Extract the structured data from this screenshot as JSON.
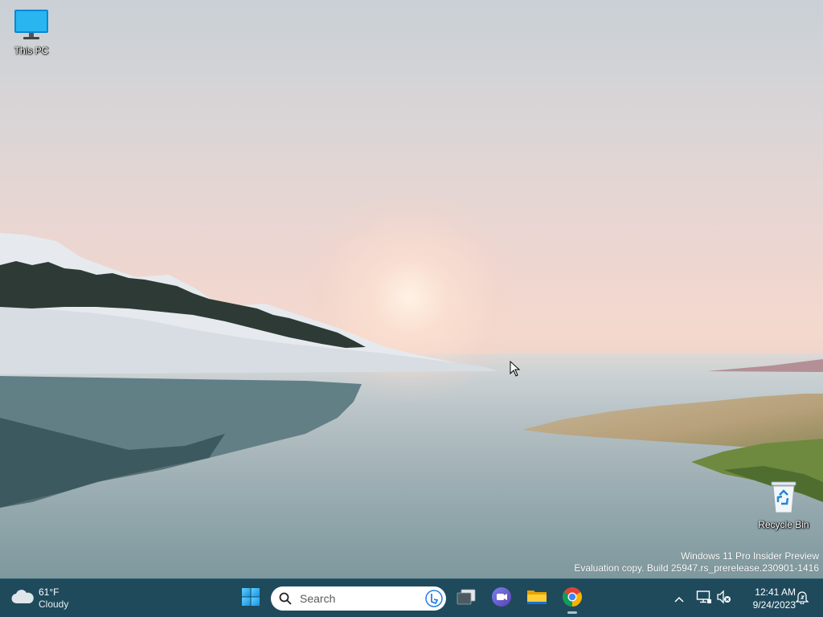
{
  "desktop": {
    "icons": [
      {
        "label": "This PC",
        "icon": "monitor-icon"
      },
      {
        "label": "Recycle Bin",
        "icon": "recycle-bin-icon"
      }
    ],
    "watermark": {
      "line1": "Windows 11 Pro Insider Preview",
      "line2": "Evaluation copy. Build 25947.rs_prerelease.230901-1416"
    }
  },
  "taskbar": {
    "weather": {
      "temperature": "61°F",
      "condition": "Cloudy",
      "icon": "cloud-icon"
    },
    "start_icon": "windows-logo-icon",
    "search": {
      "placeholder": "Search",
      "icon": "search-icon",
      "bing_icon": "bing-icon"
    },
    "apps": [
      {
        "name": "Task View",
        "icon": "task-view-icon"
      },
      {
        "name": "Teams",
        "icon": "teams-icon"
      },
      {
        "name": "File Explorer",
        "icon": "folder-icon"
      },
      {
        "name": "Google Chrome",
        "icon": "chrome-icon",
        "running": true
      }
    ],
    "tray": {
      "chevron_icon": "chevron-up-icon",
      "network_icon": "network-icon",
      "volume_icon": "volume-muted-icon",
      "time": "12:41 AM",
      "date": "9/24/2023",
      "notification_icon": "notification-bell-icon"
    }
  },
  "colors": {
    "taskbar_bg": "#1f4a5c",
    "accent_blue": "#0078d4"
  }
}
